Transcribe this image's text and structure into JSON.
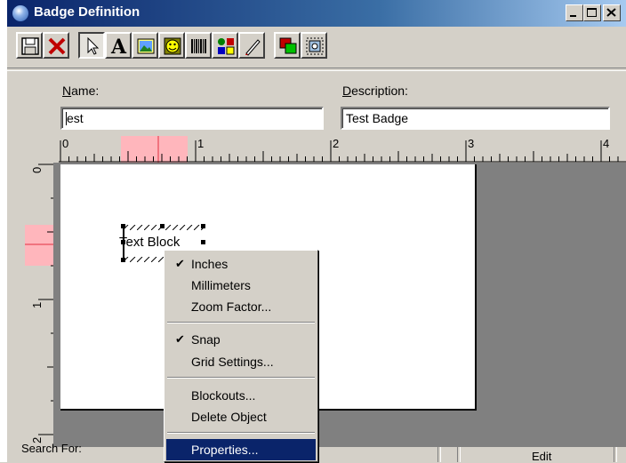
{
  "window": {
    "title": "Badge Definition"
  },
  "toolbar": {
    "buttons": [
      {
        "name": "save-icon"
      },
      {
        "name": "close-red-x-icon"
      },
      {
        "name": "pointer-icon"
      },
      {
        "name": "text-icon"
      },
      {
        "name": "image-icon"
      },
      {
        "name": "face-icon"
      },
      {
        "name": "barcode-icon"
      },
      {
        "name": "shapes-icon"
      },
      {
        "name": "pen-icon"
      },
      {
        "name": "layers-icon"
      },
      {
        "name": "capture-icon"
      }
    ]
  },
  "form": {
    "name_label_accel": "N",
    "name_label_rest": "ame:",
    "name_value": "est",
    "description_label_accel": "D",
    "description_label_rest": "escription:",
    "description_value": "Test Badge"
  },
  "ruler": {
    "h_labels": [
      "0",
      "1",
      "2",
      "3",
      "4"
    ],
    "v_labels": [
      "0",
      "1",
      "2"
    ]
  },
  "canvas": {
    "text_block_label": "Text Block"
  },
  "status": {
    "search_label": "Search For:",
    "edit_label": "Edit"
  },
  "context_menu": {
    "items": [
      {
        "label": "Inches",
        "checked": true
      },
      {
        "label": "Millimeters",
        "checked": false
      },
      {
        "label": "Zoom Factor...",
        "checked": false
      },
      {
        "label": "Snap",
        "checked": true
      },
      {
        "label": "Grid Settings...",
        "checked": false
      },
      {
        "label": "Blockouts...",
        "checked": false
      },
      {
        "label": "Delete Object",
        "checked": false
      },
      {
        "label": "Properties...",
        "checked": false,
        "selected": true
      }
    ],
    "check_glyph": "✔"
  },
  "colors": {
    "menu_highlight": "#0a246a",
    "ruler_highlight": "#ffb6bc",
    "ruler_marker": "#e03040"
  }
}
